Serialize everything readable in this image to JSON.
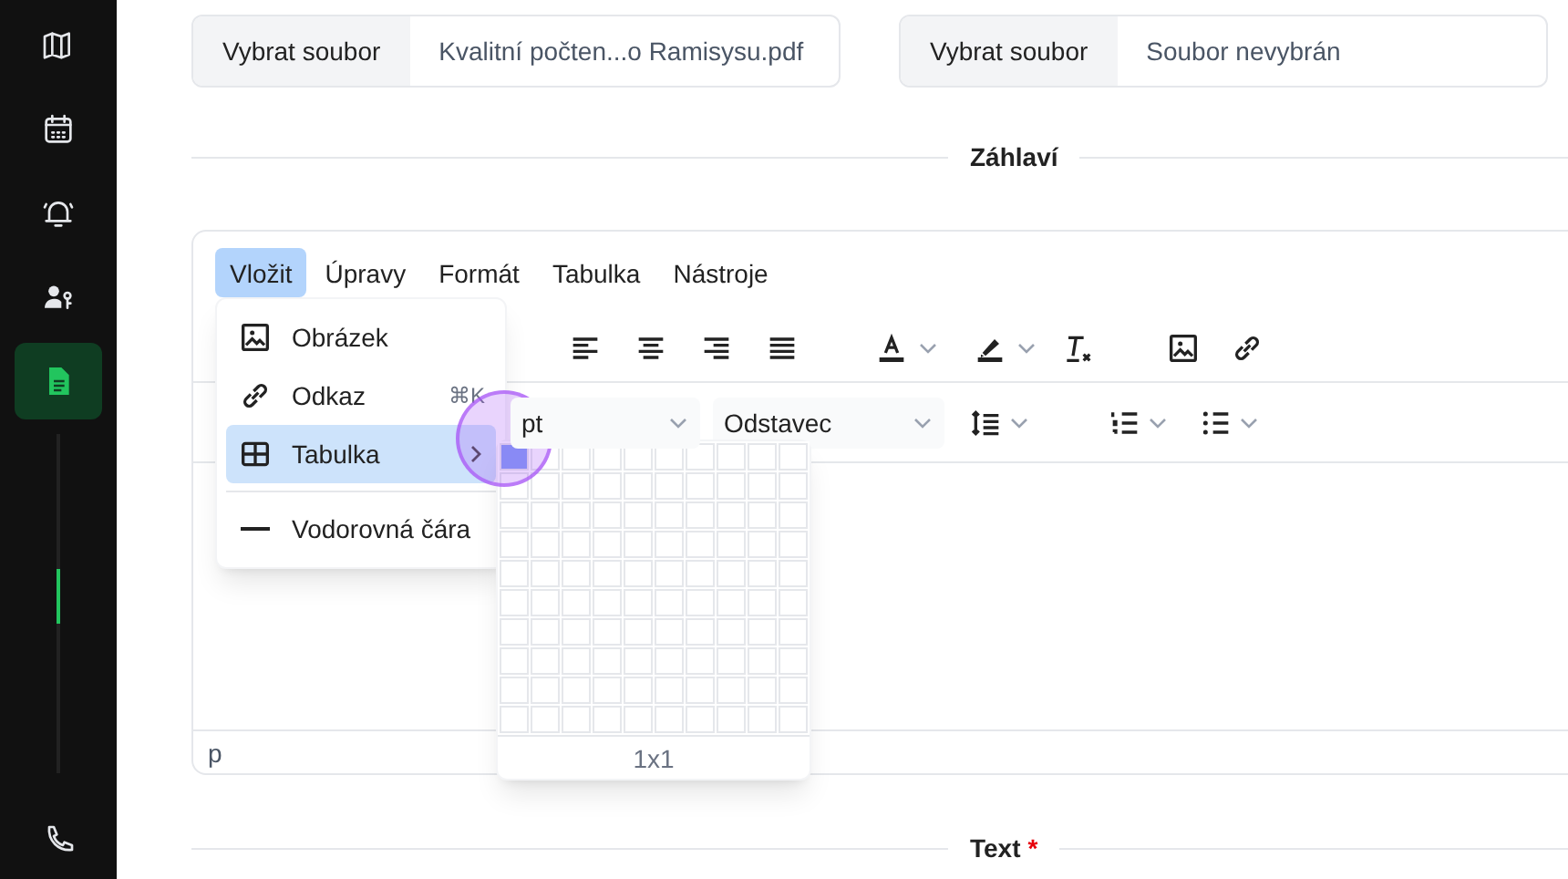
{
  "sidebar": {
    "items": [
      {
        "kind": "map",
        "selected": false
      },
      {
        "kind": "calendar",
        "selected": false
      },
      {
        "kind": "bell",
        "selected": false
      },
      {
        "kind": "user-key",
        "selected": false
      },
      {
        "kind": "document",
        "selected": true
      },
      {
        "kind": "phone",
        "selected": false
      }
    ]
  },
  "file_inputs": [
    {
      "button": "Vybrat soubor",
      "value": "Kvalitní počten...o Ramisysu.pdf"
    },
    {
      "button": "Vybrat soubor",
      "value": "Soubor nevybrán"
    }
  ],
  "header_section": {
    "title": "Záhlaví"
  },
  "editor": {
    "menubar": [
      {
        "label": "Vložit",
        "selected": true
      },
      {
        "label": "Úpravy",
        "selected": false
      },
      {
        "label": "Formát",
        "selected": false
      },
      {
        "label": "Tabulka",
        "selected": false
      },
      {
        "label": "Nástroje",
        "selected": false
      }
    ],
    "font_size": "pt",
    "block_format": "Odstavec",
    "status_path": "p"
  },
  "insert_menu": {
    "items": [
      {
        "kind": "image",
        "label": "Obrázek",
        "selected": false
      },
      {
        "kind": "link",
        "label": "Odkaz",
        "shortcut": "⌘K",
        "selected": false
      },
      {
        "kind": "table",
        "label": "Tabulka",
        "submenu": true,
        "selected": true
      },
      {
        "kind": "divider"
      },
      {
        "kind": "line",
        "label": "Vodorovná čára",
        "selected": false
      }
    ]
  },
  "table_picker": {
    "size_label": "1x1"
  },
  "text_section": {
    "title": "Text",
    "required_mark": "*"
  }
}
